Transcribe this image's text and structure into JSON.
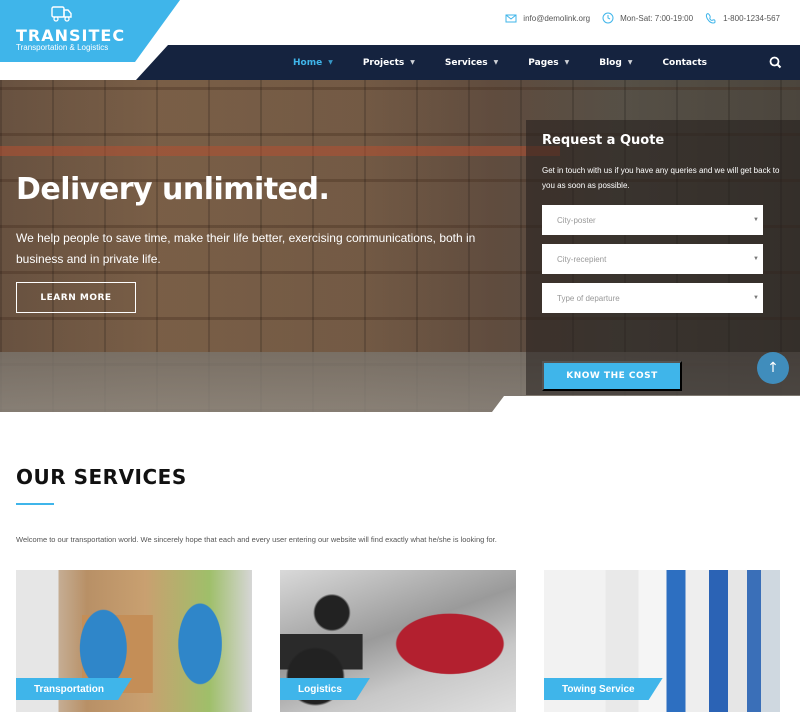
{
  "brand": {
    "name": "TRANSITEC",
    "tagline": "Transportation & Logistics",
    "accent_color": "#3fb5ea",
    "nav_color": "#15233f"
  },
  "topbar": {
    "email": "info@demolink.org",
    "hours": "Mon-Sat: 7:00-19:00",
    "phone": "1-800-1234-567"
  },
  "nav": {
    "items": [
      {
        "label": "Home",
        "has_dropdown": true,
        "active": true
      },
      {
        "label": "Projects",
        "has_dropdown": true,
        "active": false
      },
      {
        "label": "Services",
        "has_dropdown": true,
        "active": false
      },
      {
        "label": "Pages",
        "has_dropdown": true,
        "active": false
      },
      {
        "label": "Blog",
        "has_dropdown": true,
        "active": false
      },
      {
        "label": "Contacts",
        "has_dropdown": false,
        "active": false
      }
    ],
    "caret": "▼",
    "search_icon": "search-icon"
  },
  "hero": {
    "title": "Delivery unlimited.",
    "text": "We help people to save time, make their life better, exercising communications, both in business and in private life.",
    "button": "LEARN MORE"
  },
  "quote": {
    "title": "Request a Quote",
    "text": "Get in touch with us if you have any queries and we will get back to you as soon as possible.",
    "fields": [
      {
        "placeholder": "City-poster"
      },
      {
        "placeholder": "City-recepient"
      },
      {
        "placeholder": "Type of departure"
      }
    ],
    "button": "KNOW THE COST"
  },
  "scroll_top": "↑",
  "services": {
    "title": "OUR SERVICES",
    "intro": "Welcome to our transportation world. We sincerely hope that each and every user entering our website will find exactly what he/she is looking for.",
    "cards": [
      {
        "label": "Transportation"
      },
      {
        "label": "Logistics"
      },
      {
        "label": "Towing Service"
      }
    ]
  }
}
